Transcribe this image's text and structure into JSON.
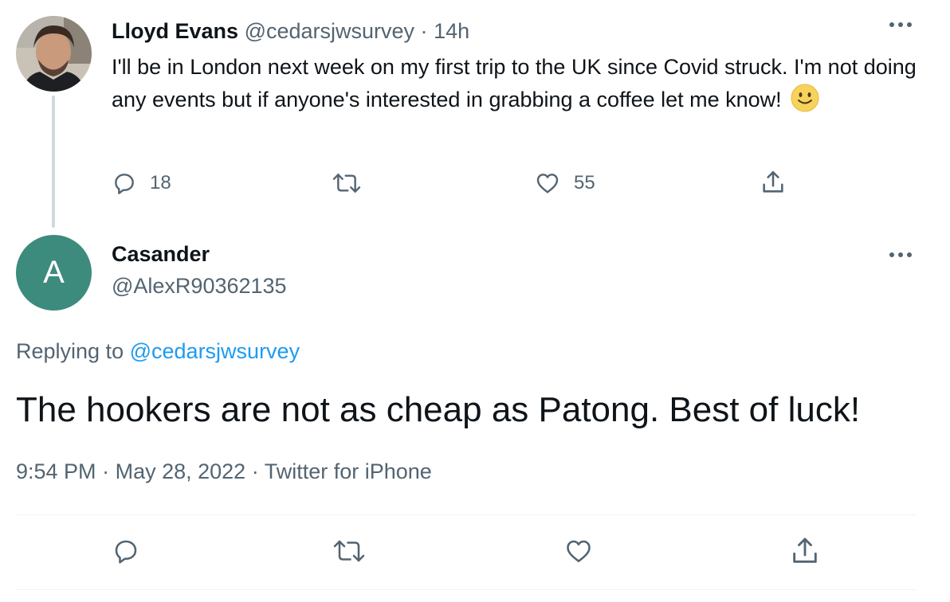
{
  "parent_tweet": {
    "display_name": "Lloyd Evans",
    "handle": "@cedarsjwsurvey",
    "separator": "·",
    "time_ago": "14h",
    "text": "I'll be in London next week on my first trip to the UK since Covid struck. I'm not doing any events but if anyone's interested in grabbing a coffee let me know!",
    "emoji": "slightly-smiling-face",
    "replies_count": "18",
    "likes_count": "55",
    "more_label": "···"
  },
  "reply_tweet": {
    "avatar_letter": "A",
    "avatar_color": "#3d8b7d",
    "display_name": "Casander",
    "handle": "@AlexR90362135",
    "replying_prefix": "Replying to",
    "replying_handle": "@cedarsjwsurvey",
    "text": "The hookers are not as cheap as Patong. Best of luck!",
    "time": "9:54 PM",
    "date": "May 28, 2022",
    "source": "Twitter for iPhone",
    "separator": "·",
    "more_label": "···"
  },
  "colors": {
    "text_primary": "#0f1419",
    "text_secondary": "#536471",
    "link": "#1d9bf0",
    "divider": "#eff3f4"
  },
  "icons": [
    "reply-icon",
    "retweet-icon",
    "like-icon",
    "share-icon",
    "more-icon"
  ]
}
